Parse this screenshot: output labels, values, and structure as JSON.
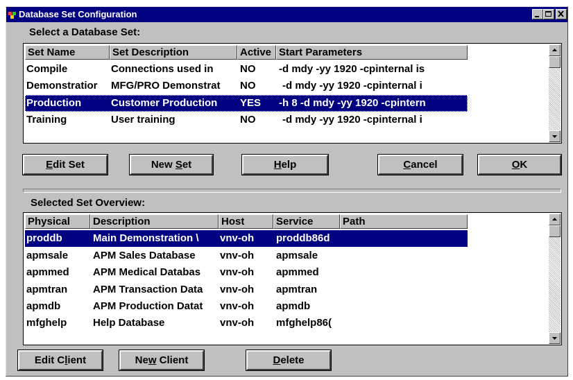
{
  "window": {
    "title": "Database Set Configuration"
  },
  "sets_label": "Select a Database Set:",
  "sets_table": {
    "headers": [
      "Set Name",
      "Set Description",
      "Active",
      "Start Parameters"
    ],
    "rows": [
      [
        "Compile",
        "Connections used in",
        "NO",
        "-d mdy -yy 1920 -cpinternal is"
      ],
      [
        "Demonstratior",
        "MFG/PRO Demonstrat",
        "NO",
        "-d mdy -yy 1920 -cpinternal i"
      ],
      [
        "Production",
        "Customer Production",
        "YES",
        "-h 8 -d mdy -yy 1920 -cpintern"
      ],
      [
        "Training",
        "User training",
        "NO",
        "-d mdy -yy 1920 -cpinternal i"
      ]
    ]
  },
  "set_buttons": {
    "edit_set": {
      "pre": "",
      "key": "E",
      "post": "dit Set"
    },
    "new_set": {
      "pre": "New ",
      "key": "S",
      "post": "et"
    },
    "help": {
      "pre": "",
      "key": "H",
      "post": "elp"
    },
    "cancel": {
      "pre": "",
      "key": "C",
      "post": "ancel"
    },
    "ok": {
      "pre": "",
      "key": "O",
      "post": "K"
    }
  },
  "overview_label": "Selected Set Overview:",
  "overview_table": {
    "headers": [
      "Physical",
      "Description",
      "Host",
      "Service",
      "Path"
    ],
    "rows": [
      [
        "proddb",
        "Main Demonstration \\",
        "vnv-oh",
        "proddb86d",
        ""
      ],
      [
        "apmsale",
        "APM Sales Database",
        "vnv-oh",
        "apmsale",
        ""
      ],
      [
        "apmmed",
        "APM Medical Databas",
        "vnv-oh",
        "apmmed",
        ""
      ],
      [
        "apmtran",
        "APM Transaction Data",
        "vnv-oh",
        "apmtran",
        ""
      ],
      [
        "apmdb",
        "APM Production Datat",
        "vnv-oh",
        "apmdb",
        ""
      ],
      [
        "mfghelp",
        "Help Database",
        "vnv-oh",
        "mfghelp86(",
        ""
      ]
    ]
  },
  "client_buttons": {
    "edit_client": {
      "pre": "Edit C",
      "key": "l",
      "post": "ient"
    },
    "new_client": {
      "pre": "Ne",
      "key": "w",
      "post": " Client"
    },
    "delete": {
      "pre": "",
      "key": "D",
      "post": "elete"
    }
  }
}
